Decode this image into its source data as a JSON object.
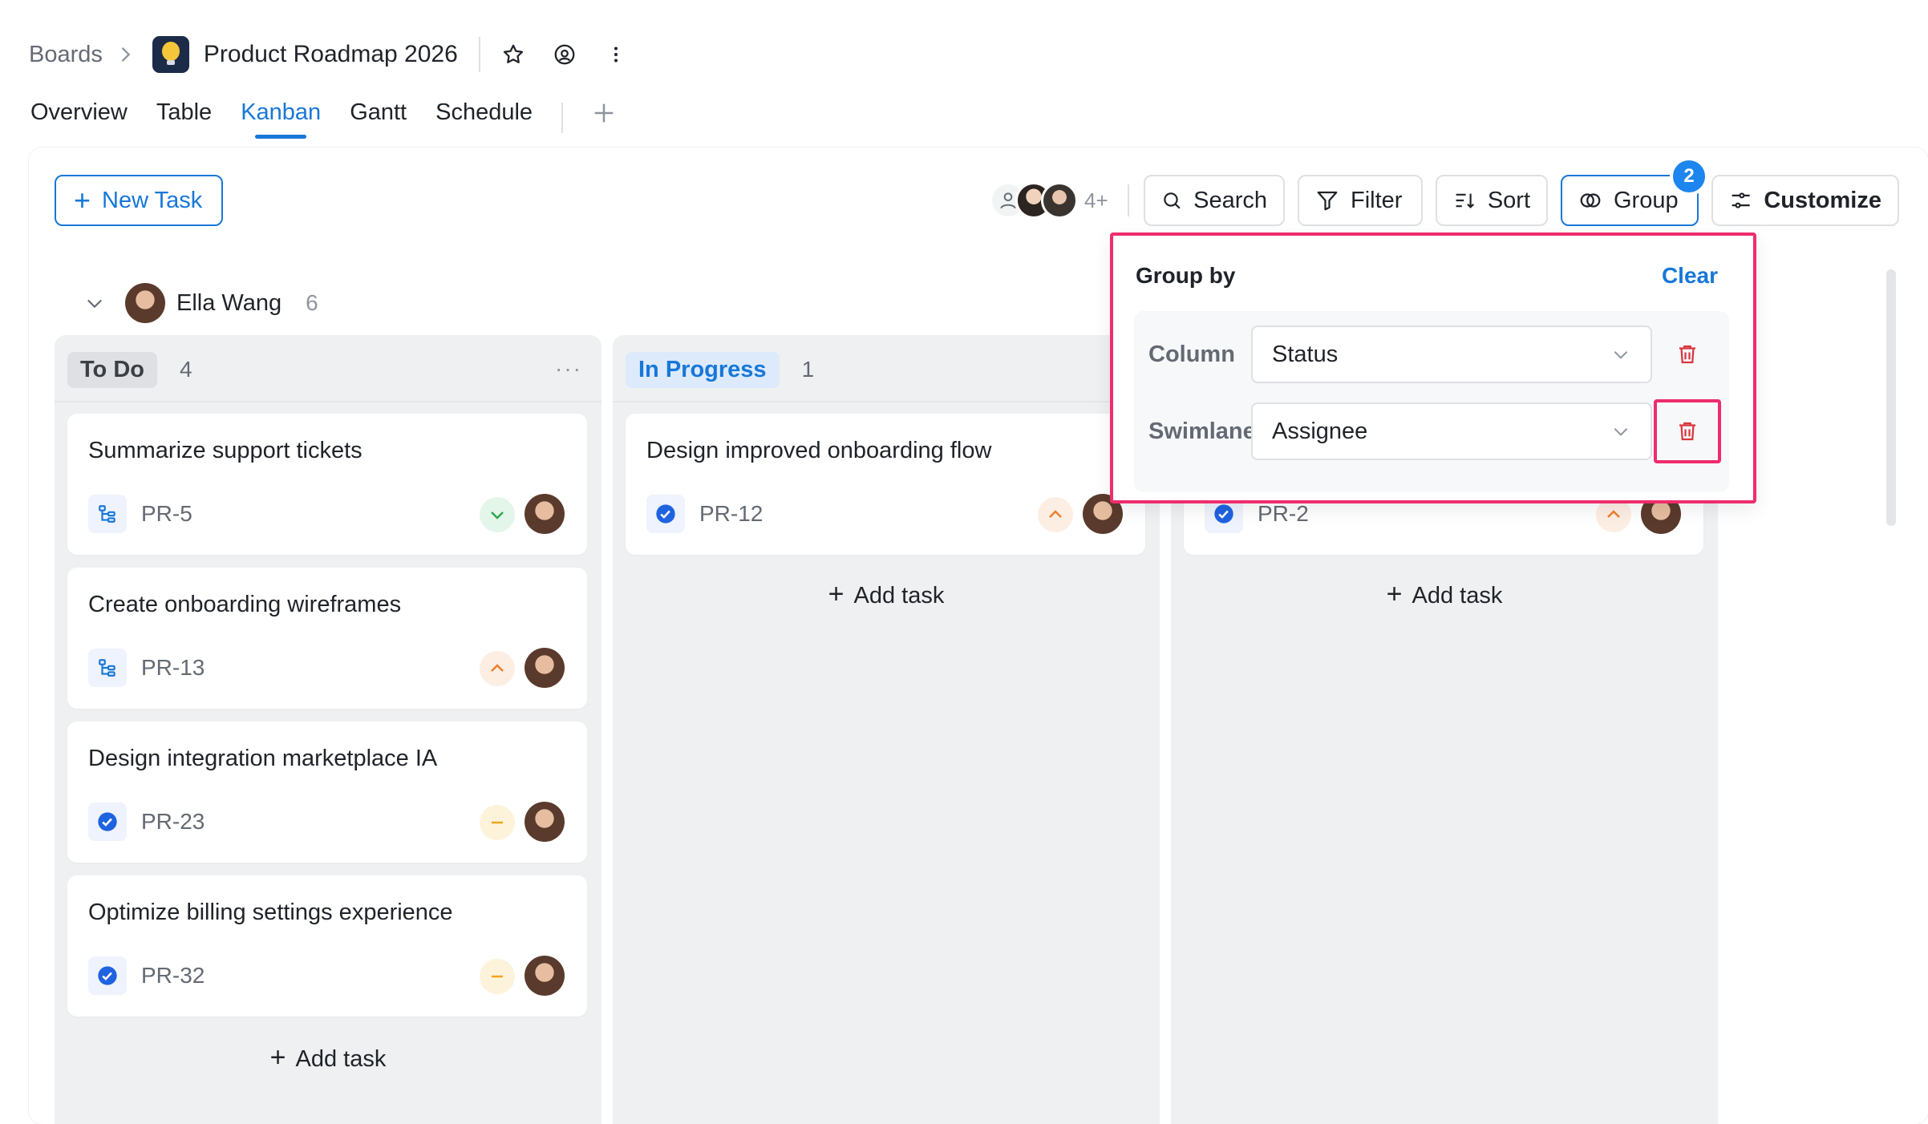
{
  "breadcrumb": {
    "root": "Boards",
    "board_title": "Product Roadmap 2026"
  },
  "tabs": [
    {
      "label": "Overview"
    },
    {
      "label": "Table"
    },
    {
      "label": "Kanban",
      "active": true
    },
    {
      "label": "Gantt"
    },
    {
      "label": "Schedule"
    }
  ],
  "toolbar": {
    "new_task": "New Task",
    "members_more": "4+",
    "search": "Search",
    "filter": "Filter",
    "sort": "Sort",
    "group": "Group",
    "group_badge": "2",
    "customize": "Customize"
  },
  "swimlane": {
    "name": "Ella Wang",
    "count": "6"
  },
  "columns": [
    {
      "label": "To Do",
      "count": "4",
      "more": "···",
      "cards": [
        {
          "title": "Summarize support tickets",
          "id": "PR-5",
          "type": "subtask-icon",
          "priority": "low"
        },
        {
          "title": "Create onboarding wireframes",
          "id": "PR-13",
          "type": "subtask-icon",
          "priority": "high"
        },
        {
          "title": "Design integration marketplace IA",
          "id": "PR-23",
          "type": "task-check-icon",
          "priority": "medium"
        },
        {
          "title": "Optimize billing settings experience",
          "id": "PR-32",
          "type": "task-check-icon",
          "priority": "medium"
        }
      ],
      "add_task": "Add task"
    },
    {
      "label": "In Progress",
      "count": "1",
      "cards": [
        {
          "title": "Design improved onboarding flow",
          "id": "PR-12",
          "type": "task-check-icon",
          "priority": "high"
        }
      ],
      "add_task": "Add task"
    },
    {
      "cards": [
        {
          "id": "PR-2",
          "type": "task-check-icon",
          "priority": "high"
        }
      ],
      "add_task": "Add task"
    }
  ],
  "group_popover": {
    "title": "Group by",
    "clear": "Clear",
    "rows": [
      {
        "label": "Column",
        "value": "Status"
      },
      {
        "label": "Swimlane",
        "value": "Assignee"
      }
    ]
  },
  "colors": {
    "accent": "#1877d8",
    "highlight": "#ee2d6c",
    "delete": "#d9363e",
    "priority_low": "#2ea84f",
    "priority_high": "#f07d2b",
    "priority_medium": "#f2a51a"
  }
}
